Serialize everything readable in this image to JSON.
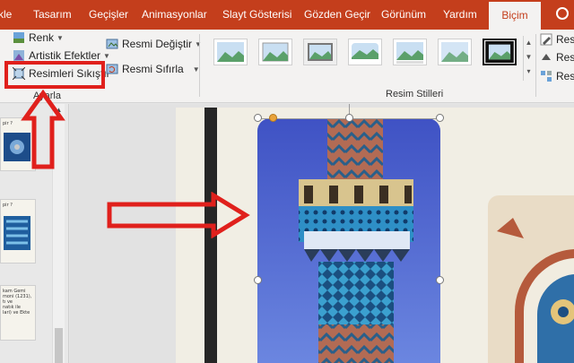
{
  "ribbon_tabs": [
    "kle",
    "Tasarım",
    "Geçişler",
    "Animasyonlar",
    "Slayt Gösterisi",
    "Gözden Geçir",
    "Görünüm",
    "Yardım",
    "Biçim"
  ],
  "active_tab": "Biçim",
  "adjust_group": {
    "color_label": "Renk",
    "artistic_label": "Artistik Efektler",
    "compress_label": "Resimleri Sıkıştır",
    "change_label": "Resmi Değiştir",
    "reset_label": "Resmi Sıfırla",
    "group_label": "Ayarla"
  },
  "styles_group": {
    "group_label": "Resim Stilleri",
    "style_count": 8
  },
  "right_group": {
    "items": [
      "Resi",
      "Resi",
      "Resi"
    ]
  },
  "slides": [
    {
      "title": "pir ?"
    },
    {
      "title": "pir ?"
    },
    {
      "title": "kam Gemi\nmoni (1231),\ntı ve\nnatık ile\nlari) ve Ekte"
    }
  ],
  "colors": {
    "ribbon_red": "#c43e1c",
    "highlight_red": "#e0201c",
    "sky_blue": "#4a5fc9",
    "tile_blue": "#2f8fc4"
  }
}
